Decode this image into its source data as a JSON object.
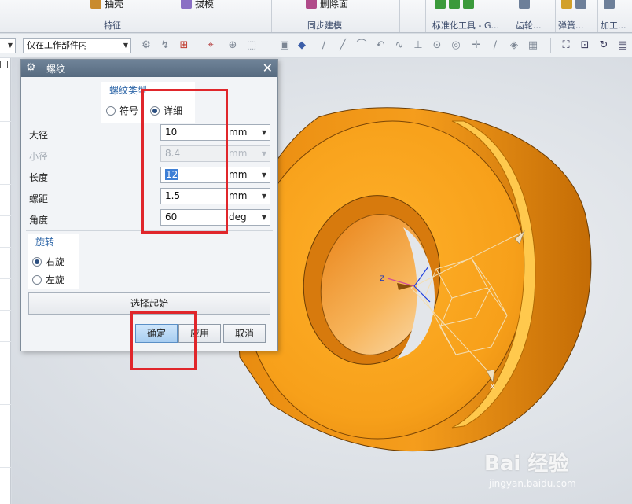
{
  "ribbon": {
    "items": [
      {
        "label": "抽壳",
        "color": "#c98b2e"
      },
      {
        "label": "拔模",
        "color": "#8a6fc4"
      },
      {
        "label": "删除面",
        "color": "#b04a8a"
      },
      {
        "label": "标准化工具 - G...",
        "color": "#3b9a3b"
      },
      {
        "label": "齿轮...",
        "color": "#6d7f99"
      },
      {
        "label": "弹簧...",
        "color": "#6d7f99"
      },
      {
        "label": "加工...",
        "color": "#6d7f99"
      }
    ],
    "groups": [
      "特征",
      "同步建模",
      "标准化工具 - G...",
      "齿轮...",
      "弹簧...",
      "加工..."
    ]
  },
  "toolbar": {
    "filter_value": "仅在工作部件内"
  },
  "dialog": {
    "title": "螺纹",
    "thread_type": {
      "label": "螺纹类型",
      "options": [
        "符号",
        "详细"
      ],
      "selected": "详细"
    },
    "params": [
      {
        "label": "大径",
        "value": "10",
        "unit": "mm",
        "disabled": false
      },
      {
        "label": "小径",
        "value": "8.4",
        "unit": "mm",
        "disabled": true
      },
      {
        "label": "长度",
        "value": "12",
        "unit": "mm",
        "disabled": false,
        "selected": true
      },
      {
        "label": "螺距",
        "value": "1.5",
        "unit": "mm",
        "disabled": false
      },
      {
        "label": "角度",
        "value": "60",
        "unit": "deg",
        "disabled": false
      }
    ],
    "rotation": {
      "label": "旋转",
      "options": [
        "右旋",
        "左旋"
      ],
      "selected": "右旋"
    },
    "select_start_label": "选择起始",
    "buttons": {
      "ok": "确定",
      "apply": "应用",
      "cancel": "取消"
    }
  },
  "viewport": {
    "axis_labels": {
      "z": "Z",
      "x": "X"
    },
    "part_color": "#f5a21a",
    "watermark": {
      "logo": "Bai 经验",
      "url": "jingyan.baidu.com"
    }
  },
  "colors": {
    "annotation": "#e0262b",
    "title_bar": "#5f7389",
    "primary_button": "#a7cdf1"
  }
}
